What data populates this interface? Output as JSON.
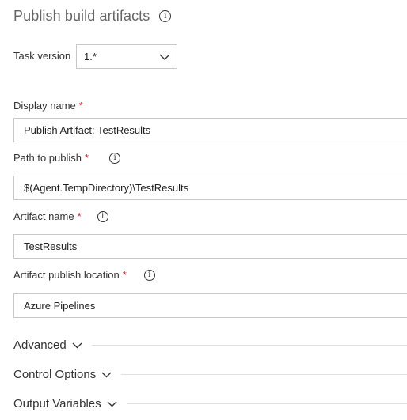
{
  "title": "Publish build artifacts",
  "task_version": {
    "label": "Task version",
    "value": "1.*"
  },
  "fields": {
    "display_name": {
      "label": "Display name",
      "required_mark": "*",
      "value": "Publish Artifact: TestResults"
    },
    "path_to_publish": {
      "label": "Path to publish",
      "required_mark": "*",
      "value": "$(Agent.TempDirectory)\\TestResults"
    },
    "artifact_name": {
      "label": "Artifact name",
      "required_mark": "*",
      "value": "TestResults"
    },
    "publish_location": {
      "label": "Artifact publish location",
      "required_mark": "*",
      "value": "Azure Pipelines"
    }
  },
  "info_glyph": "i",
  "sections": {
    "advanced": "Advanced",
    "control_options": "Control Options",
    "output_variables": "Output Variables"
  },
  "icons": {
    "info": "info-circle-icon",
    "chevron": "chevron-down-icon"
  },
  "colors": {
    "required": "#c4262e",
    "border": "#c8c8c8",
    "title": "#666666"
  }
}
